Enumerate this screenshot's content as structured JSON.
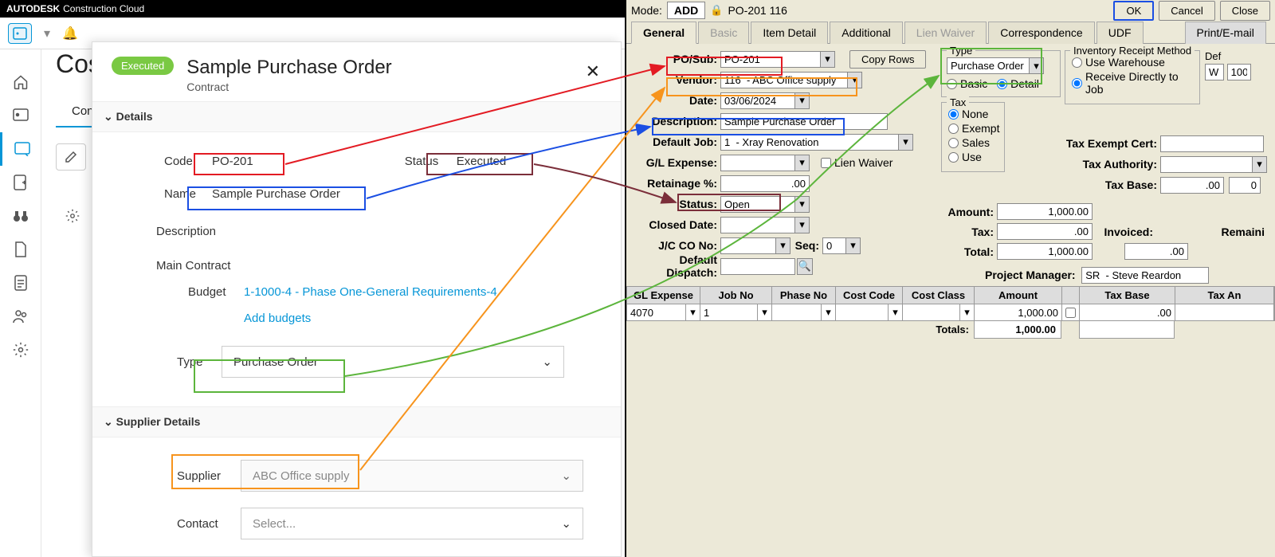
{
  "autodesk": {
    "brand": "AUTODESK",
    "product": "Construction Cloud",
    "page_title_prefix": "Cos",
    "tab_label": "Contr",
    "modal": {
      "badge": "Executed",
      "title": "Sample Purchase Order",
      "subtitle": "Contract",
      "sections": {
        "details": "Details",
        "supplier": "Supplier Details"
      },
      "fields": {
        "code_label": "Code",
        "code_value": "PO-201",
        "status_label": "Status",
        "status_value": "Executed",
        "name_label": "Name",
        "name_value": "Sample Purchase Order",
        "description_label": "Description",
        "main_contract_label": "Main Contract",
        "budget_label": "Budget",
        "budget_value": "1-1000-4 - Phase One-General Requirements-4",
        "add_budgets": "Add budgets",
        "type_label": "Type",
        "type_value": "Purchase Order",
        "supplier_label": "Supplier",
        "supplier_value": "ABC Office supply",
        "contact_label": "Contact",
        "contact_placeholder": "Select..."
      }
    }
  },
  "erp": {
    "mode_label": "Mode:",
    "mode_value": "ADD",
    "header_ref": "PO-201  116",
    "buttons": {
      "ok": "OK",
      "cancel": "Cancel",
      "close": "Close"
    },
    "tabs": [
      "General",
      "Basic",
      "Item Detail",
      "Additional",
      "Lien Waiver",
      "Correspondence",
      "UDF"
    ],
    "print_tab": "Print/E-mail",
    "col1": {
      "posub_label": "PO/Sub:",
      "posub_value": "PO-201",
      "copy_rows": "Copy Rows",
      "vendor_label": "Vendor:",
      "vendor_value": "116  - ABC Office supply",
      "date_label": "Date:",
      "date_value": "03/06/2024",
      "description_label": "Description:",
      "description_value": "Sample Purchase Order",
      "default_job_label": "Default Job:",
      "default_job_value": "1  - Xray Renovation",
      "gl_expense_label": "G/L Expense:",
      "lien_waiver": "Lien Waiver",
      "retainage_label": "Retainage %:",
      "retainage_value": ".00",
      "status_label": "Status:",
      "status_value": "Open",
      "closed_date_label": "Closed Date:",
      "jcco_label": "J/C CO No:",
      "seq_label": "Seq:",
      "seq_value": "0",
      "dispatch_label": "Default Dispatch:"
    },
    "type_box": {
      "label": "Type",
      "value": "Purchase Order",
      "basic": "Basic",
      "detail": "Detail"
    },
    "tax_box": {
      "label": "Tax",
      "none": "None",
      "exempt": "Exempt",
      "sales": "Sales",
      "use": "Use"
    },
    "inv_receipt": {
      "label": "Inventory Receipt Method",
      "def_label": "Def",
      "warehouse": "Use Warehouse",
      "receive": "Receive Directly to Job",
      "w_val": "W",
      "j_val": "100"
    },
    "tax_fields": {
      "cert": "Tax Exempt Cert:",
      "authority": "Tax Authority:",
      "base": "Tax Base:",
      "base_val": ".00",
      "base_pct": "0"
    },
    "amounts": {
      "amount_label": "Amount:",
      "amount_value": "1,000.00",
      "tax_label": "Tax:",
      "tax_value": ".00",
      "total_label": "Total:",
      "total_value": "1,000.00",
      "invoiced_label": "Invoiced:",
      "remaining_label": "Remaini",
      "inv_val": ".00"
    },
    "pm_label": "Project Manager:",
    "pm_value": "SR  - Steve Reardon",
    "grid": {
      "headers": [
        "GL Expense",
        "Job No",
        "Phase No",
        "Cost Code",
        "Cost Class",
        "Amount",
        "",
        "Tax Base",
        "Tax An"
      ],
      "row": {
        "gl": "4070",
        "job": "1",
        "amount": "1,000.00",
        "taxbase": ".00"
      },
      "totals_label": "Totals:",
      "totals_amount": "1,000.00"
    }
  }
}
